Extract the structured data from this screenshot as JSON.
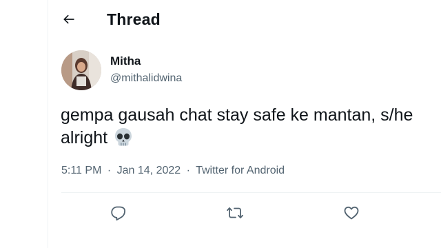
{
  "header": {
    "title": "Thread",
    "back_icon": "arrow-left-icon"
  },
  "tweet": {
    "author": {
      "display_name": "Mitha",
      "username": "@mithalidwina"
    },
    "text_line1": "gempa gausah chat stay safe ke mantan, s/he",
    "text_line2": "alright",
    "emoji": "skull-emoji",
    "time": "5:11 PM",
    "date": "Jan 14, 2022",
    "separator": "·",
    "source": "Twitter for Android"
  },
  "actions": {
    "reply_icon": "reply-icon",
    "retweet_icon": "retweet-icon",
    "like_icon": "heart-icon"
  },
  "colors": {
    "text": "#0f1419",
    "secondary": "#536471",
    "divider": "#eff3f4"
  }
}
